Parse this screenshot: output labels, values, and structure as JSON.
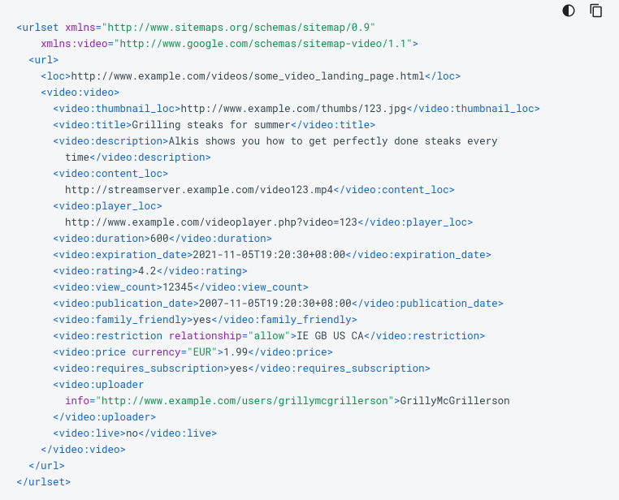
{
  "toolbar": {
    "theme_icon": "dark-mode-icon",
    "copy_icon": "copy-icon"
  },
  "xml": {
    "urlset_open": "<urlset",
    "xmlns_attr": " xmlns",
    "xmlns_val": "\"http://www.sitemaps.org/schemas/sitemap/0.9\"",
    "xmlns_video_attr": " xmlns:video",
    "xmlns_video_val": "\"http://www.google.com/schemas/sitemap-video/1.1\"",
    "close_angle": ">",
    "url_open": "<url>",
    "loc_open": "<loc>",
    "loc_text": "http://www.example.com/videos/some_video_landing_page.html",
    "loc_close": "</loc>",
    "video_open": "<video:video>",
    "thumb_open": "<video:thumbnail_loc>",
    "thumb_text": "http://www.example.com/thumbs/123.jpg",
    "thumb_close": "</video:thumbnail_loc>",
    "title_open": "<video:title>",
    "title_text": "Grilling steaks for summer",
    "title_close": "</video:title>",
    "desc_open": "<video:description>",
    "desc_text1": "Alkis shows you how to get perfectly done steaks every",
    "desc_text2": "time",
    "desc_close": "</video:description>",
    "content_open": "<video:content_loc>",
    "content_text": "http://streamserver.example.com/video123.mp4",
    "content_close": "</video:content_loc>",
    "player_open": "<video:player_loc>",
    "player_text": "http://www.example.com/videoplayer.php?video=123",
    "player_close": "</video:player_loc>",
    "duration_open": "<video:duration>",
    "duration_text": "600",
    "duration_close": "</video:duration>",
    "exp_open": "<video:expiration_date>",
    "exp_text": "2021-11-05T19:20:30+08:00",
    "exp_close": "</video:expiration_date>",
    "rating_open": "<video:rating>",
    "rating_text": "4.2",
    "rating_close": "</video:rating>",
    "view_open": "<video:view_count>",
    "view_text": "12345",
    "view_close": "</video:view_count>",
    "pub_open": "<video:publication_date>",
    "pub_text": "2007-11-05T19:20:30+08:00",
    "pub_close": "</video:publication_date>",
    "fam_open": "<video:family_friendly>",
    "fam_text": "yes",
    "fam_close": "</video:family_friendly>",
    "restr_open": "<video:restriction",
    "restr_attr": " relationship",
    "restr_val": "\"allow\"",
    "restr_text": "IE GB US CA",
    "restr_close": "</video:restriction>",
    "price_open": "<video:price",
    "price_attr": " currency",
    "price_val": "\"EUR\"",
    "price_text": "1.99",
    "price_close": "</video:price>",
    "sub_open": "<video:requires_subscription>",
    "sub_text": "yes",
    "sub_close": "</video:requires_subscription>",
    "upl_open": "<video:uploader",
    "upl_attr": "info",
    "upl_val": "\"http://www.example.com/users/grillymcgrillerson\"",
    "upl_text": "GrillyMcGrillerson",
    "upl_close": "</video:uploader>",
    "live_open": "<video:live>",
    "live_text": "no",
    "live_close": "</video:live>",
    "video_close": "</video:video>",
    "url_close": "</url>",
    "urlset_close": "</urlset>"
  }
}
